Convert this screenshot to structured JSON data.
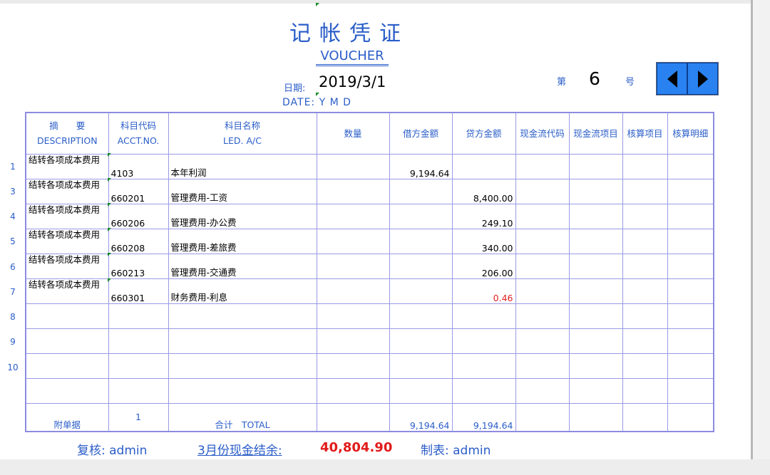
{
  "voucher": {
    "title": "记帐凭证",
    "subtitle": "VOUCHER",
    "date_label": "日期:",
    "date_value": "2019/3/1",
    "date_ymd": "DATE: Y  M  D",
    "no_prefix": "第",
    "no_value": "6",
    "no_suffix": "号"
  },
  "nav": {
    "prev_icon": "triangle-left-icon",
    "next_icon": "triangle-right-icon",
    "button_color": "#2a82f0"
  },
  "columns": {
    "desc_cn": "摘　　要",
    "desc_en": "DESCRIPTION",
    "acct_cn": "科目代码",
    "acct_en": "ACCT.NO.",
    "led_cn": "科目名称",
    "led_en": "LED. A/C",
    "qty": "数量",
    "debit": "借方金额",
    "credit": "贷方金额",
    "cf_code": "现金流代码",
    "cf_item": "现金流项目",
    "audit_item": "核算项目",
    "audit_detail": "核算明细"
  },
  "row_numbers": [
    "1",
    "3",
    "4",
    "5",
    "6",
    "7",
    "8",
    "9",
    "10"
  ],
  "rows": [
    {
      "desc": "结转各项成本费用",
      "acct": "4103",
      "name": "本年利润",
      "debit": "9,194.64",
      "credit": ""
    },
    {
      "desc": "结转各项成本费用",
      "acct": "660201",
      "name": "管理费用-工资",
      "debit": "",
      "credit": "8,400.00"
    },
    {
      "desc": "结转各项成本费用",
      "acct": "660206",
      "name": "管理费用-办公费",
      "debit": "",
      "credit": "249.10"
    },
    {
      "desc": "结转各项成本费用",
      "acct": "660208",
      "name": "管理费用-差旅费",
      "debit": "",
      "credit": "340.00"
    },
    {
      "desc": "结转各项成本费用",
      "acct": "660213",
      "name": "管理费用-交通费",
      "debit": "",
      "credit": "206.00"
    },
    {
      "desc": "结转各项成本费用",
      "acct": "660301",
      "name": "财务费用-利息",
      "debit": "",
      "credit": "0.46"
    }
  ],
  "summary": {
    "attach_label": "附单据",
    "attach_count": "1",
    "total_label": "合计　TOTAL",
    "debit_total": "9,194.64",
    "credit_total": "9,194.64"
  },
  "footer": {
    "reviewer": "复核: admin",
    "cash_label": "3月份现金结余:",
    "cash_value": "40,804.90",
    "preparer": "制表: admin"
  },
  "colors": {
    "accent": "#2a5dc8",
    "grid": "#9a9ae6",
    "negative": "#e02020"
  }
}
